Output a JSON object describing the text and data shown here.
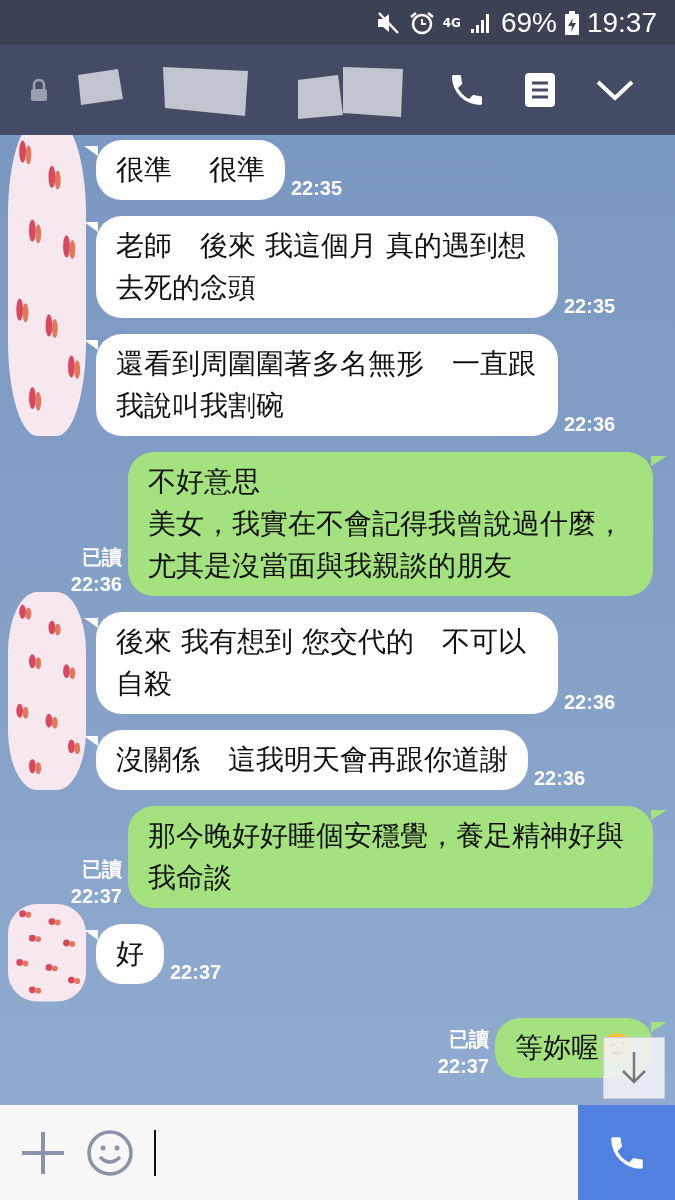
{
  "status_bar": {
    "network": "4G",
    "battery": "69%",
    "time": "19:37"
  },
  "groups": [
    {
      "kind": "incoming",
      "messages": [
        {
          "lines": [
            "很準　 很準"
          ],
          "time": "22:35"
        },
        {
          "lines": [
            "老師　後來 我這個月 真的遇到想去死的念頭"
          ],
          "time": "22:35"
        },
        {
          "lines": [
            "還看到周圍圍著多名無形　一直跟我說叫我割碗"
          ],
          "time": "22:36"
        }
      ]
    },
    {
      "kind": "outgoing",
      "messages": [
        {
          "lines": [
            "不好意思",
            "美女，我實在不會記得我曾說過什麼，尤其是沒當面與我親談的朋友"
          ],
          "time": "22:36",
          "read": "已讀"
        }
      ]
    },
    {
      "kind": "incoming",
      "messages": [
        {
          "lines": [
            "後來 我有想到 您交代的　不可以自殺"
          ],
          "time": "22:36"
        },
        {
          "lines": [
            "沒關係　這我明天會再跟你道謝"
          ],
          "time": "22:36"
        }
      ]
    },
    {
      "kind": "outgoing",
      "messages": [
        {
          "lines": [
            "那今晚好好睡個安穩覺，養足精神好與我命談"
          ],
          "time": "22:37",
          "read": "已讀"
        }
      ]
    },
    {
      "kind": "incoming",
      "messages": [
        {
          "lines": [
            "好"
          ],
          "time": "22:37"
        }
      ]
    },
    {
      "kind": "outgoing",
      "messages": [
        {
          "lines": [
            "等妳喔"
          ],
          "time": "22:37",
          "read": "已讀",
          "emoji": true
        }
      ]
    }
  ]
}
